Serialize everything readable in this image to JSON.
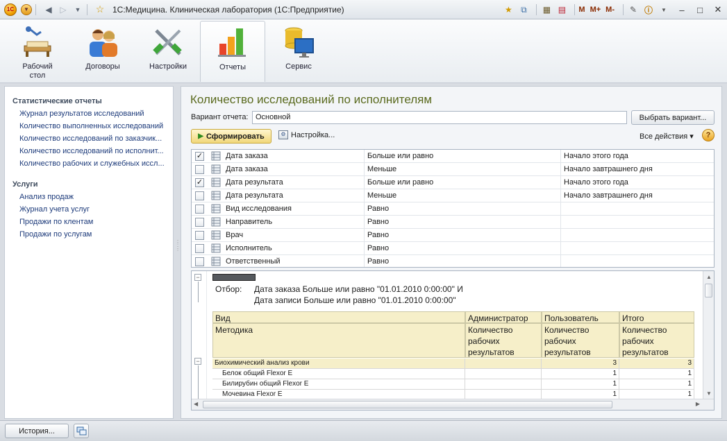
{
  "titlebar": {
    "title": "1С:Медицина. Клиническая лаборатория  (1С:Предприятие)",
    "memory_buttons": [
      "M",
      "M+",
      "M-"
    ]
  },
  "sections": [
    {
      "label": "Рабочий стол",
      "icon": "desk-icon"
    },
    {
      "label": "Договоры",
      "icon": "people-icon"
    },
    {
      "label": "Настройки",
      "icon": "tools-icon"
    },
    {
      "label": "Отчеты",
      "icon": "bar-chart-icon",
      "active": true
    },
    {
      "label": "Сервис",
      "icon": "database-monitor-icon"
    }
  ],
  "left_panel": {
    "groups": [
      {
        "title": "Статистические отчеты",
        "items": [
          "Журнал результатов исследований",
          "Количество выполненных исследований",
          "Количество исследований по заказчик...",
          "Количество исследований по исполнит...",
          "Количество рабочих и служебных иссл..."
        ]
      },
      {
        "title": "Услуги",
        "items": [
          "Анализ продаж",
          "Журнал учета услуг",
          "Продажи по клентам",
          "Продажи по услугам"
        ]
      }
    ]
  },
  "report": {
    "title": "Количество исследований по исполнителям",
    "variant_label": "Вариант отчета:",
    "variant_value": "Основной",
    "choose_variant_button": "Выбрать вариант...",
    "generate_button": "Сформировать",
    "settings_button": "Настройка...",
    "all_actions": "Все действия ▾",
    "help": "?"
  },
  "filters": [
    {
      "checked": true,
      "field": "Дата заказа",
      "condition": "Больше или равно",
      "value": "Начало этого года"
    },
    {
      "checked": false,
      "field": "Дата заказа",
      "condition": "Меньше",
      "value": "Начало завтрашнего дня"
    },
    {
      "checked": true,
      "field": "Дата результата",
      "condition": "Больше или равно",
      "value": "Начало этого года"
    },
    {
      "checked": false,
      "field": "Дата результата",
      "condition": "Меньше",
      "value": "Начало завтрашнего дня"
    },
    {
      "checked": false,
      "field": "Вид исследования",
      "condition": "Равно",
      "value": ""
    },
    {
      "checked": false,
      "field": "Направитель",
      "condition": "Равно",
      "value": ""
    },
    {
      "checked": false,
      "field": "Врач",
      "condition": "Равно",
      "value": ""
    },
    {
      "checked": false,
      "field": "Исполнитель",
      "condition": "Равно",
      "value": ""
    },
    {
      "checked": false,
      "field": "Ответственный",
      "condition": "Равно",
      "value": ""
    }
  ],
  "output": {
    "filter_label": "Отбор:",
    "filter_line1": "Дата заказа Больше или равно \"01.01.2010 0:00:00\" И",
    "filter_line2": "Дата записи Больше или равно \"01.01.2010 0:00:00\"",
    "headers": {
      "col1_row1": "Вид",
      "col1_row2": "Методика",
      "col2_row1": "Администратор",
      "col2_row2": "Количество рабочих результатов",
      "col3_row1": "Пользователь",
      "col3_row2": "Количество рабочих результатов",
      "col4_row1": "Итого",
      "col4_row2": "Количество рабочих результатов"
    },
    "rows": [
      {
        "name": "Биохимический анализ крови",
        "admin": "",
        "user": "3",
        "total": "3",
        "group": true
      },
      {
        "name": "Белок общий Flexor E",
        "admin": "",
        "user": "1",
        "total": "1",
        "group": false
      },
      {
        "name": "Билирубин общий Flexor E",
        "admin": "",
        "user": "1",
        "total": "1",
        "group": false
      },
      {
        "name": "Мочевина Flexor E",
        "admin": "",
        "user": "1",
        "total": "1",
        "group": false
      }
    ]
  },
  "bottom": {
    "history_button": "История..."
  }
}
